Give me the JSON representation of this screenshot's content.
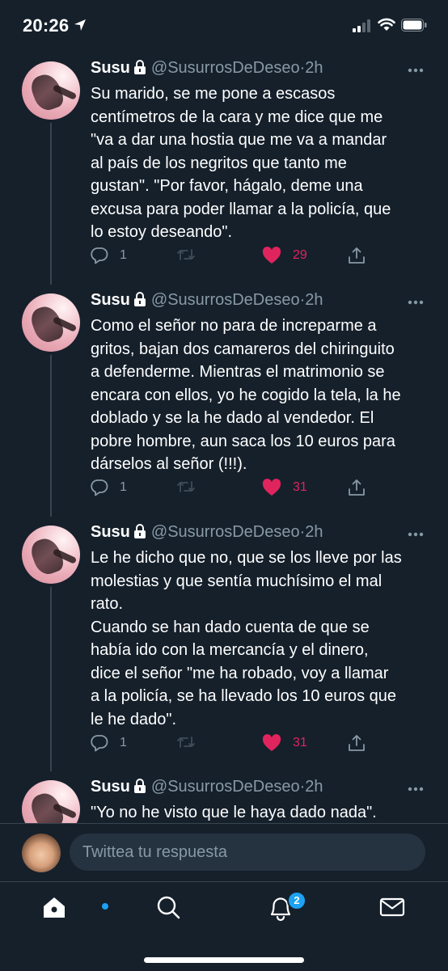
{
  "status_bar": {
    "time": "20:26"
  },
  "tweets": [
    {
      "name": "Susu",
      "handle": "@SusurrosDeDeseo",
      "separator": "·",
      "time": "2h",
      "text": "Su marido, se me pone a escasos\ncentímetros de la cara y me dice que me\n\"va a dar una hostia que me va a mandar\nal país de los negritos que tanto me\ngustan\". \"Por favor, hágalo, deme una\nexcusa para poder llamar a la policía, que\nlo estoy deseando\".",
      "replies": "1",
      "likes": "29"
    },
    {
      "name": "Susu",
      "handle": "@SusurrosDeDeseo",
      "separator": "·",
      "time": "2h",
      "text": "Como el señor no para de increparme a\ngritos, bajan dos camareros del chiringuito\na defenderme. Mientras el matrimonio se\nencara con ellos, yo he cogido la tela, la he\ndoblado y se la he dado al vendedor. El\npobre hombre, aun saca los 10 euros para\ndárselos al señor (!!!).",
      "replies": "1",
      "likes": "31"
    },
    {
      "name": "Susu",
      "handle": "@SusurrosDeDeseo",
      "separator": "·",
      "time": "2h",
      "text": "Le he dicho que no, que se los lleve por las\nmolestias y que sentía muchísimo el mal\nrato.\nCuando se han dado cuenta de que se\nhabía ido con la mercancía y el dinero,\ndice el señor \"me ha robado, voy a llamar\na la policía, se ha llevado los 10 euros que\nle he dado\".",
      "replies": "1",
      "likes": "31"
    },
    {
      "name": "Susu",
      "handle": "@SusurrosDeDeseo",
      "separator": "·",
      "time": "2h",
      "text": "\"Yo no he visto que le haya dado nada\"."
    }
  ],
  "reply_bar": {
    "placeholder": "Twittea tu respuesta"
  },
  "tab_bar": {
    "items": [
      "home-icon",
      "search-icon",
      "notifications-icon",
      "messages-icon"
    ],
    "notifications_badge": "2"
  },
  "colors": {
    "background": "#15202b",
    "secondary_text": "#8899a6",
    "like_pink": "#e0245e",
    "accent_blue": "#1da1f2"
  }
}
